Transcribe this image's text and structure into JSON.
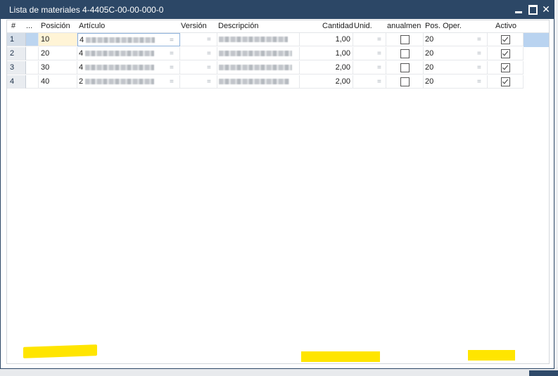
{
  "window": {
    "title": "Lista de materiales 4-4405C-00-00-000-0",
    "minimize_icon": "minimize-icon",
    "maximize_icon": "maximize-icon",
    "close_icon": "close-icon",
    "close_glyph": "✕"
  },
  "table": {
    "headers": {
      "num": "#",
      "dots": "...",
      "position": "Posición",
      "article": "Artículo",
      "version": "Versión",
      "description": "Descripción",
      "quantity": "Cantidad",
      "unit": "Unid.",
      "manual": "anualmen",
      "pos_oper": "Pos. Oper.",
      "active": "Activo"
    },
    "rows": [
      {
        "num": "1",
        "position": "10",
        "article_prefix": "4",
        "desc_prefix": "",
        "quantity": "1,00",
        "manual": false,
        "pos_oper": "20",
        "active": true
      },
      {
        "num": "2",
        "position": "20",
        "article_prefix": "4",
        "desc_prefix": "",
        "quantity": "1,00",
        "manual": false,
        "pos_oper": "20",
        "active": true
      },
      {
        "num": "3",
        "position": "30",
        "article_prefix": "4",
        "desc_prefix": "",
        "quantity": "2,00",
        "manual": false,
        "pos_oper": "20",
        "active": true
      },
      {
        "num": "4",
        "position": "40",
        "article_prefix": "2",
        "desc_prefix": "",
        "quantity": "2,00",
        "manual": false,
        "pos_oper": "20",
        "active": true
      }
    ],
    "link_glyph": "="
  },
  "colors": {
    "titlebar": "#2c4766",
    "highlight": "#ffe500",
    "selection": "#b9d3f0"
  }
}
